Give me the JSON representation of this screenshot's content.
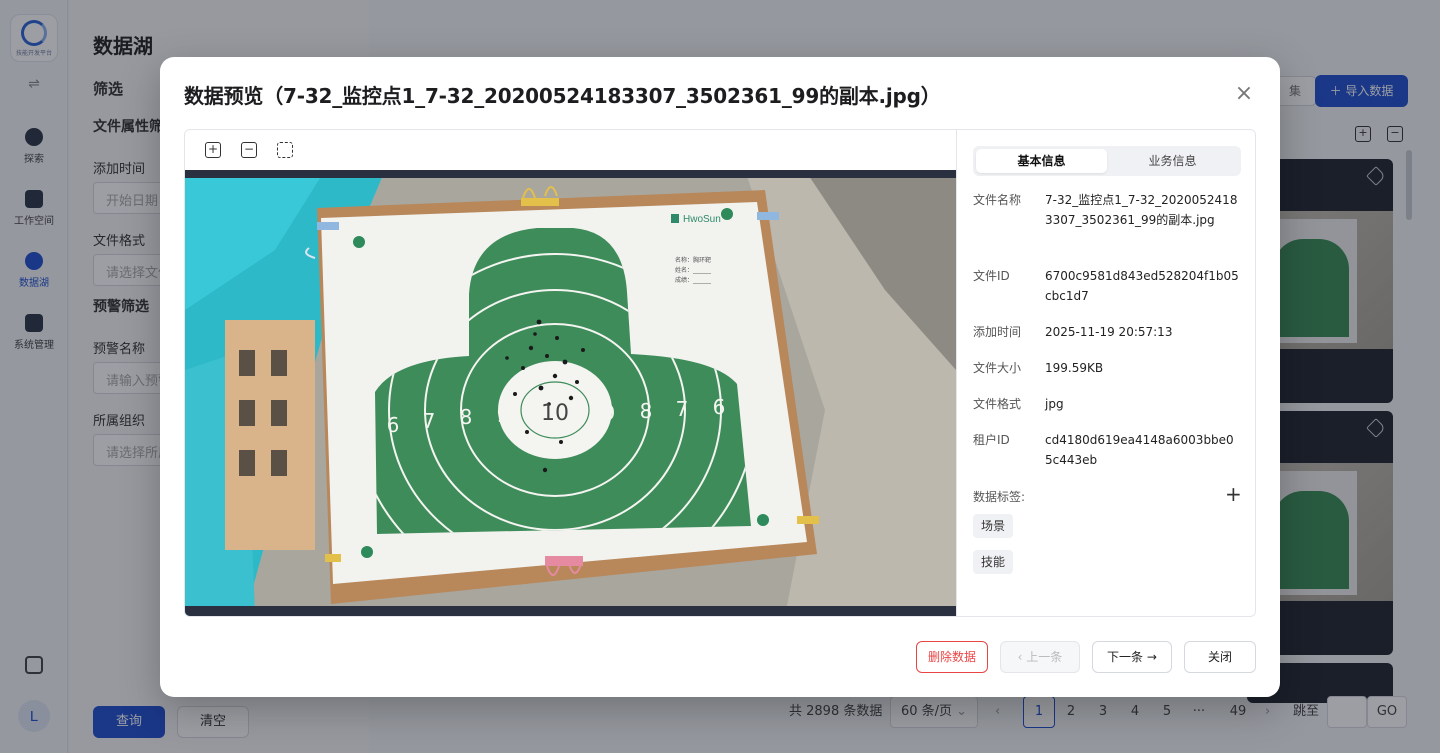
{
  "app": {
    "logo_caption": "技能开发平台",
    "nav": [
      {
        "label": "探索",
        "icon": "planet-icon"
      },
      {
        "label": "工作空间",
        "icon": "terminal-icon"
      },
      {
        "label": "数据湖",
        "icon": "database-icon"
      },
      {
        "label": "系统管理",
        "icon": "server-icon"
      }
    ],
    "user_initial": "L",
    "accent_color": "#1f4fd0"
  },
  "page": {
    "title": "数据湖",
    "filter": {
      "heading": "筛选",
      "file_attr_heading": "文件属性筛",
      "add_time_label": "添加时间",
      "add_time_placeholder": "开始日期",
      "file_format_label": "文件格式",
      "file_format_placeholder": "请选择文件",
      "warning_heading": "预警筛选",
      "warning_name_label": "预警名称",
      "warning_name_placeholder": "请输入预警",
      "org_label": "所属组织",
      "org_placeholder": "请选择所属",
      "query_button": "查询",
      "clear_button": "清空"
    },
    "toolbar": {
      "collect_button": "集",
      "import_button": "导入数据"
    },
    "pagination": {
      "total": "共 2898 条数据",
      "page_size": "60 条/页",
      "pages": [
        "1",
        "2",
        "3",
        "4",
        "5",
        "···",
        "49"
      ],
      "current_page": "1",
      "jump_label": "跳至",
      "go_button": "GO"
    }
  },
  "modal": {
    "title": "数据预览（7-32_监控点1_7-32_20200524183307_3502361_99的副本.jpg）",
    "tabs": [
      "基本信息",
      "业务信息"
    ],
    "active_tab": "基本信息",
    "fields": [
      {
        "key": "文件名称",
        "value": "7-32_监控点1_7-32_20200524183307_3502361_99的副本.jpg"
      },
      {
        "key": "文件ID",
        "value": "6700c9581d843ed528204f1b05cbc1d7"
      },
      {
        "key": "添加时间",
        "value": "2025-11-19 20:57:13"
      },
      {
        "key": "文件大小",
        "value": "199.59KB"
      },
      {
        "key": "文件格式",
        "value": "jpg"
      },
      {
        "key": "租户ID",
        "value": "cd4180d619ea4148a6003bbe05c443eb"
      }
    ],
    "tags_label": "数据标签:",
    "tags": [
      "场景",
      "技能"
    ],
    "image": {
      "brand": "HwoSun",
      "form_lines": [
        "名称：胸环靶",
        "姓名：______",
        "成绩：______"
      ],
      "ring_numbers_left": [
        "6",
        "7",
        "8",
        "9"
      ],
      "center": "10",
      "ring_numbers_right": [
        "9",
        "8",
        "7",
        "6"
      ],
      "target_color": "#3e8c5a"
    },
    "buttons": {
      "delete": "删除数据",
      "prev": "上一条",
      "next": "下一条",
      "close": "关闭"
    }
  }
}
